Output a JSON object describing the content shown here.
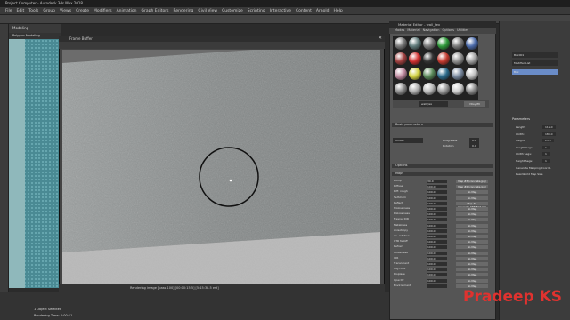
{
  "app": {
    "title": "Project Computer - Autodesk 3ds Max 2018"
  },
  "menu": [
    "File",
    "Edit",
    "Tools",
    "Group",
    "Views",
    "Create",
    "Modifiers",
    "Animation",
    "Graph Editors",
    "Rendering",
    "Civil View",
    "Customize",
    "Scripting",
    "Interactive",
    "Content",
    "Arnold",
    "Help"
  ],
  "ribbon": {
    "tab1": "Modeling",
    "tab2": "Polygon Modeling"
  },
  "frame_buffer": {
    "title": "Frame Buffer",
    "status": "Rendering image [pass 100] [00:00:15.5] [5:15:38.5 est]"
  },
  "material_editor": {
    "title": "Material Editor - wall_tex",
    "menu": [
      "Modes",
      "Material",
      "Navigation",
      "Options",
      "Utilities"
    ],
    "material_name": "wall_tex",
    "material_type": "VRayMtl",
    "rollouts": [
      "Basic parameters",
      "Options",
      "Maps"
    ],
    "diffuse_label": "Diffuse",
    "basic": [
      {
        "label": "Roughness",
        "value": "0.0"
      },
      {
        "label": "Rotation",
        "value": "0.0"
      }
    ],
    "maps": [
      {
        "label": "Bump",
        "amt": "30.0",
        "map": "Map #3 (concrete.jpg)"
      },
      {
        "label": "Diffuse",
        "amt": "100.0",
        "map": "Map #2 (concrete.jpg)"
      },
      {
        "label": "Diff. rough",
        "amt": "100.0",
        "map": "No Map"
      },
      {
        "label": "Self-illum",
        "amt": "100.0",
        "map": "No Map"
      },
      {
        "label": "Reflect",
        "amt": "100.0",
        "map": "Map #4 (concrete.REFLECT.jpg)"
      },
      {
        "label": "HGlossiness",
        "amt": "100.0",
        "map": "No Map"
      },
      {
        "label": "RGlossiness",
        "amt": "100.0",
        "map": "No Map"
      },
      {
        "label": "Fresnel IOR",
        "amt": "100.0",
        "map": "No Map"
      },
      {
        "label": "Metalness",
        "amt": "100.0",
        "map": "No Map"
      },
      {
        "label": "Anisotropy",
        "amt": "100.0",
        "map": "No Map"
      },
      {
        "label": "An. rotation",
        "amt": "100.0",
        "map": "No Map"
      },
      {
        "label": "GTR falloff",
        "amt": "100.0",
        "map": "No Map"
      },
      {
        "label": "Refract",
        "amt": "100.0",
        "map": "No Map"
      },
      {
        "label": "Glossiness",
        "amt": "100.0",
        "map": "No Map"
      },
      {
        "label": "IOR",
        "amt": "100.0",
        "map": "No Map"
      },
      {
        "label": "Translucent",
        "amt": "100.0",
        "map": "No Map"
      },
      {
        "label": "Fog color",
        "amt": "100.0",
        "map": "No Map"
      },
      {
        "label": "Displace",
        "amt": "100.0",
        "map": "No Map"
      },
      {
        "label": "Opacity",
        "amt": "100.0",
        "map": "No Map"
      },
      {
        "label": "Environment",
        "amt": "",
        "map": "No Map"
      }
    ]
  },
  "command_panel": {
    "object_name": "Box001",
    "modifier_list": "Modifier List",
    "stack_item": "Box",
    "section": "Parameters",
    "params": [
      {
        "label": "Length:",
        "value": "112.0"
      },
      {
        "label": "Width:",
        "value": "187.0"
      },
      {
        "label": "Height:",
        "value": "25.0"
      },
      {
        "label": "Length Segs:",
        "value": "1"
      },
      {
        "label": "Width Segs:",
        "value": "1"
      },
      {
        "label": "Height Segs:",
        "value": "1"
      }
    ],
    "check1": "Generate Mapping Coords.",
    "check2": "Real-World Map Size"
  },
  "status_bar": {
    "selection": "1 Object Selected",
    "render_time": "Rendering Time: 0:00:11"
  },
  "watermark": "Pradeep KS"
}
